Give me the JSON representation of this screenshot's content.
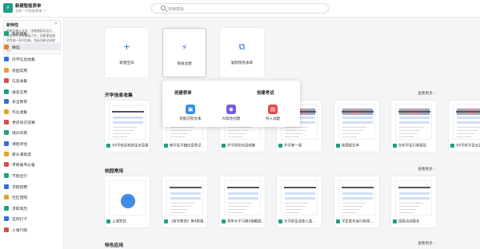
{
  "topbar": {
    "logo": "⚡",
    "title": "新建智能表单",
    "subtitle": "全新一代智能表单 ⓘ",
    "search_placeholder": "搜索模板"
  },
  "notice": {
    "title": "新特性",
    "body": "智能问卷以业务，由数据驱动设计，在提供专业化模板之外，还能更快速地完成一系列功能，包括问卷全局统计，多维度分析，更加自由与可定制。",
    "close": "✕"
  },
  "sidebar": {
    "items": [
      {
        "label": "我的模板",
        "color": "#1f9e86"
      },
      {
        "label": "精选",
        "color": "#f07a2c",
        "active": true
      },
      {
        "label": "开学信息收集",
        "color": "#2f6fd8"
      },
      {
        "label": "校园常用",
        "color": "#e3a12a"
      },
      {
        "label": "信息收集",
        "color": "#d94c4c"
      },
      {
        "label": "报名应用",
        "color": "#1f9e86"
      },
      {
        "label": "安全教育",
        "color": "#2f6fd8"
      },
      {
        "label": "作业收集",
        "color": "#e3a12a"
      },
      {
        "label": "党史知识竞赛",
        "color": "#d94c4c"
      },
      {
        "label": "培训问卷",
        "color": "#1f9e86"
      },
      {
        "label": "课程评估",
        "color": "#2f6fd8"
      },
      {
        "label": "家长满意度",
        "color": "#e3a12a"
      },
      {
        "label": "考研备考必备",
        "color": "#d94c4c"
      },
      {
        "label": "节假出行",
        "color": "#1f9e86"
      },
      {
        "label": "求职招聘",
        "color": "#2f6fd8"
      },
      {
        "label": "社区团购",
        "color": "#e3a12a"
      },
      {
        "label": "求职简历",
        "color": "#1f9e86"
      },
      {
        "label": "签到打卡",
        "color": "#2f6fd8"
      },
      {
        "label": "人事行政",
        "color": "#d94c4c"
      }
    ]
  },
  "create": [
    {
      "label": "新建空白",
      "glyph": "+"
    },
    {
      "label": "快速创建",
      "glyph": "⚡",
      "selected": true
    },
    {
      "label": "复制现有表单",
      "glyph": "⧉"
    }
  ],
  "popup": {
    "form_title": "创建表单",
    "exam_title": "创建考试",
    "options": [
      {
        "label": "智能识别文本",
        "color": "#2f8fe8",
        "glyph": "▣"
      },
      {
        "label": "AI帮你创建",
        "color": "#7a5be0",
        "glyph": "◆"
      },
      {
        "label": "导入试题",
        "color": "#e44b4b",
        "glyph": "▤"
      }
    ]
  },
  "sections": [
    {
      "title": "开学信息收集",
      "more": "查看更多 ›",
      "cards": [
        {
          "label": "XX学校返校新生信息报..."
        },
        {
          "label": "转学生学籍信息登记"
        },
        {
          "label": "开学防控信息收集"
        },
        {
          "label": "开学第一课"
        },
        {
          "label": "收费报告单"
        },
        {
          "label": "在校学生行程报告"
        },
        {
          "label": "XX学校学生信息登记..."
        }
      ]
    },
    {
      "title": "校园常用",
      "more": "查看更多 ›",
      "cards": [
        {
          "label": "上课签到"
        },
        {
          "label": "《安全教育》第4章课..."
        },
        {
          "label": "青年大学习第X期截图..."
        },
        {
          "label": "大学新生调查入选..."
        },
        {
          "label": "学生家长会行程调..."
        },
        {
          "label": "班级活动报名"
        }
      ]
    },
    {
      "title": "特色应用",
      "more": "查看更多 ›"
    }
  ]
}
